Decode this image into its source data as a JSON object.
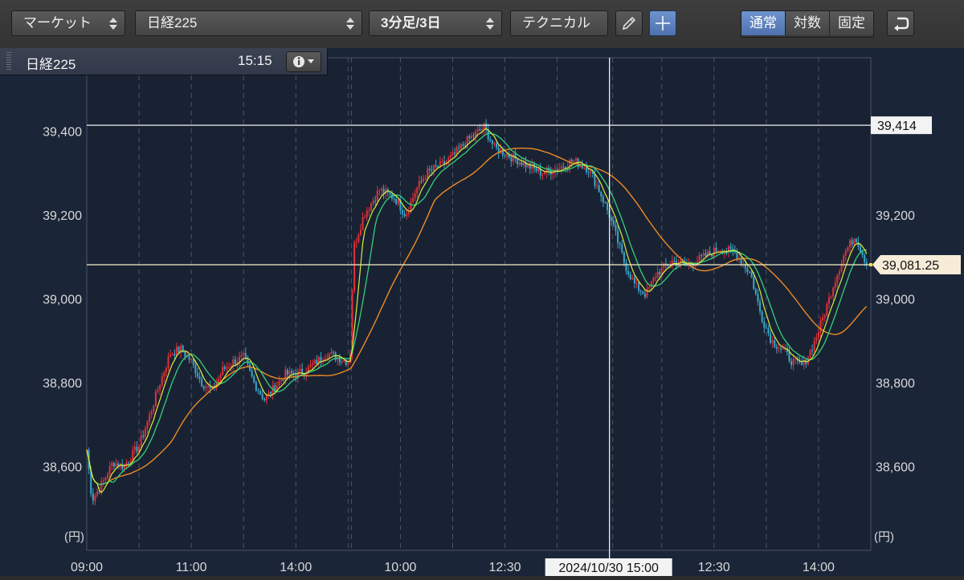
{
  "toolbar": {
    "market_select": "マーケット",
    "symbol_select": "日経225",
    "period_select": "3分足/3日",
    "technical_button": "テクニカル",
    "pen_icon": "pencil-icon",
    "crosshair_icon": "crosshair-icon",
    "scale_modes": [
      "通常",
      "対数",
      "固定"
    ],
    "active_scale_mode": "通常",
    "undo_icon": "undo-icon"
  },
  "info_panel": {
    "symbol": "日経225",
    "time": "15:15",
    "info_icon": "info-icon"
  },
  "colors": {
    "background": "#1b2538",
    "up_candle": "#e0313a",
    "down_candle": "#3aa6c9",
    "ma_short": "#d8ee3c",
    "ma_mid": "#34d07a",
    "ma_long": "#f08a24",
    "crosshair": "#f2f2f2",
    "accent": "#5b7fbf"
  },
  "chart_data": {
    "type": "candlestick",
    "unit_label": "(円)",
    "y_ticks_left": [
      "39,400",
      "39,200",
      "39,000",
      "38,800",
      "38,600"
    ],
    "y_ticks_right": [
      "39,200",
      "39,000",
      "38,800",
      "38,600"
    ],
    "ylim": [
      38400,
      39575
    ],
    "x_ticks": [
      {
        "label": "09:00",
        "slot": 0
      },
      {
        "label": "11:00",
        "slot": 2
      },
      {
        "label": "14:00",
        "slot": 4
      },
      {
        "label": "10:00",
        "slot": 6
      },
      {
        "label": "12:30",
        "slot": 8
      },
      {
        "label": "12:30",
        "slot": 12
      },
      {
        "label": "14:00",
        "slot": 14
      }
    ],
    "slots": 15,
    "day_breaks": [
      5,
      10
    ],
    "crosshair": {
      "slot": 10,
      "price": 39414,
      "price_label": "39,414",
      "time_label": "2024/10/30 15:00"
    },
    "last_price": {
      "value": 39081.25,
      "label": "39,081.25"
    },
    "price_path": [
      [
        0,
        38640
      ],
      [
        0.1,
        38520
      ],
      [
        0.3,
        38560
      ],
      [
        0.5,
        38610
      ],
      [
        0.7,
        38600
      ],
      [
        1.0,
        38650
      ],
      [
        1.2,
        38720
      ],
      [
        1.4,
        38800
      ],
      [
        1.6,
        38870
      ],
      [
        1.8,
        38880
      ],
      [
        2.0,
        38850
      ],
      [
        2.2,
        38800
      ],
      [
        2.4,
        38780
      ],
      [
        2.6,
        38830
      ],
      [
        2.8,
        38850
      ],
      [
        3.0,
        38860
      ],
      [
        3.2,
        38800
      ],
      [
        3.4,
        38760
      ],
      [
        3.6,
        38790
      ],
      [
        3.8,
        38820
      ],
      [
        4.0,
        38820
      ],
      [
        4.2,
        38830
      ],
      [
        4.4,
        38850
      ],
      [
        4.6,
        38870
      ],
      [
        4.8,
        38860
      ],
      [
        5.0,
        38850
      ],
      [
        5.05,
        38880
      ],
      [
        5.1,
        39120
      ],
      [
        5.3,
        39200
      ],
      [
        5.6,
        39260
      ],
      [
        5.9,
        39240
      ],
      [
        6.1,
        39200
      ],
      [
        6.3,
        39260
      ],
      [
        6.5,
        39300
      ],
      [
        6.8,
        39320
      ],
      [
        7.0,
        39340
      ],
      [
        7.3,
        39380
      ],
      [
        7.6,
        39410
      ],
      [
        7.8,
        39360
      ],
      [
        8.1,
        39340
      ],
      [
        8.4,
        39320
      ],
      [
        8.7,
        39300
      ],
      [
        9.0,
        39310
      ],
      [
        9.3,
        39330
      ],
      [
        9.6,
        39310
      ],
      [
        9.8,
        39260
      ],
      [
        10.0,
        39200
      ],
      [
        10.1,
        39160
      ],
      [
        10.3,
        39080
      ],
      [
        10.5,
        39030
      ],
      [
        10.7,
        39010
      ],
      [
        10.9,
        39060
      ],
      [
        11.2,
        39090
      ],
      [
        11.5,
        39080
      ],
      [
        11.8,
        39100
      ],
      [
        12.1,
        39120
      ],
      [
        12.4,
        39110
      ],
      [
        12.7,
        39060
      ],
      [
        12.9,
        38960
      ],
      [
        13.1,
        38900
      ],
      [
        13.3,
        38880
      ],
      [
        13.5,
        38850
      ],
      [
        13.7,
        38840
      ],
      [
        13.9,
        38890
      ],
      [
        14.1,
        38960
      ],
      [
        14.3,
        39040
      ],
      [
        14.5,
        39110
      ],
      [
        14.7,
        39150
      ],
      [
        14.8,
        39120
      ],
      [
        14.93,
        39081
      ]
    ]
  }
}
